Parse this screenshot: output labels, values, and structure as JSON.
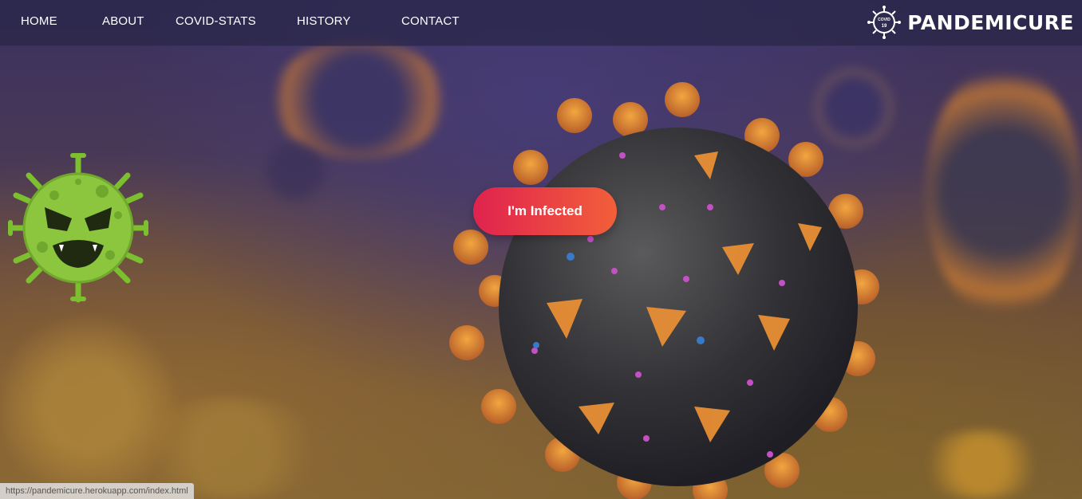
{
  "nav": {
    "items": [
      {
        "label": "HOME"
      },
      {
        "label": "ABOUT"
      },
      {
        "label": "COVID-STATS"
      },
      {
        "label": "HISTORY"
      },
      {
        "label": "CONTACT"
      }
    ]
  },
  "brand": {
    "name": "PANDEMICURE",
    "logo_text": "COVID 19",
    "logo_icon": "virus-logo-icon"
  },
  "hero": {
    "button_label": "I'm Infected",
    "mascot_icon": "green-virus-mascot-icon"
  },
  "status_bar": {
    "url": "https://pandemicure.herokuapp.com/index.html"
  },
  "colors": {
    "button_start": "#e0224e",
    "button_end": "#f25f3a",
    "mascot": "#8cc63f"
  }
}
